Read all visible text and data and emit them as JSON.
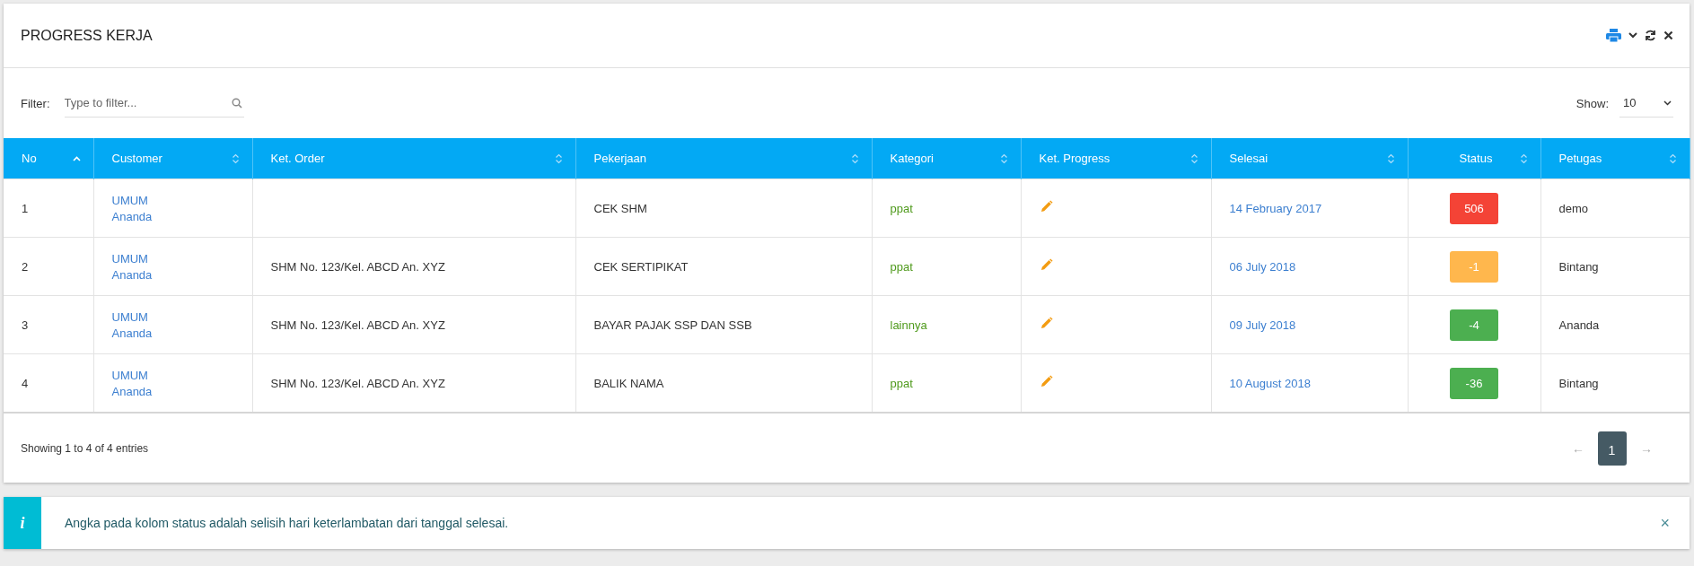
{
  "panel": {
    "title": "PROGRESS KERJA"
  },
  "filter": {
    "label": "Filter:",
    "placeholder": "Type to filter..."
  },
  "show": {
    "label": "Show:",
    "value": "10"
  },
  "table": {
    "columns": [
      {
        "label": "No",
        "sorted": true
      },
      {
        "label": "Customer",
        "sorted": false
      },
      {
        "label": "Ket. Order",
        "sorted": false
      },
      {
        "label": "Pekerjaan",
        "sorted": false
      },
      {
        "label": "Kategori",
        "sorted": false
      },
      {
        "label": "Ket. Progress",
        "sorted": false
      },
      {
        "label": "Selesai",
        "sorted": false
      },
      {
        "label": "Status",
        "sorted": false
      },
      {
        "label": "Petugas",
        "sorted": false
      }
    ],
    "rows": [
      {
        "no": "1",
        "customer": [
          "UMUM",
          "Ananda"
        ],
        "ket_order": "",
        "pekerjaan": "CEK SHM",
        "kategori": "ppat",
        "selesai": "14 February 2017",
        "status": "506",
        "color": "#f44336",
        "petugas": "demo"
      },
      {
        "no": "2",
        "customer": [
          "UMUM",
          "Ananda"
        ],
        "ket_order": "SHM No. 123/Kel. ABCD An. XYZ",
        "pekerjaan": "CEK SERTIPIKAT",
        "kategori": "ppat",
        "selesai": "06 July 2018",
        "status": "-1",
        "color": "#ffb74d",
        "petugas": "Bintang"
      },
      {
        "no": "3",
        "customer": [
          "UMUM",
          "Ananda"
        ],
        "ket_order": "SHM No. 123/Kel. ABCD An. XYZ",
        "pekerjaan": "BAYAR PAJAK SSP DAN SSB",
        "kategori": "lainnya",
        "selesai": "09 July 2018",
        "status": "-4",
        "color": "#4caf50",
        "petugas": "Ananda"
      },
      {
        "no": "4",
        "customer": [
          "UMUM",
          "Ananda"
        ],
        "ket_order": "SHM No. 123/Kel. ABCD An. XYZ",
        "pekerjaan": "BALIK NAMA",
        "kategori": "ppat",
        "selesai": "10 August 2018",
        "status": "-36",
        "color": "#4caf50",
        "petugas": "Bintang"
      }
    ]
  },
  "footer": {
    "info": "Showing 1 to 4 of 4 entries",
    "pages": [
      {
        "label": "←",
        "kind": "prev",
        "disabled": true,
        "selected": false
      },
      {
        "label": "1",
        "kind": "page",
        "disabled": false,
        "selected": true
      },
      {
        "label": "→",
        "kind": "next",
        "disabled": true,
        "selected": false
      }
    ]
  },
  "alert": {
    "icon": "i",
    "message": "Angka pada kolom status adalah selisih hari keterlambatan dari tanggal selesai.",
    "close": "×"
  }
}
